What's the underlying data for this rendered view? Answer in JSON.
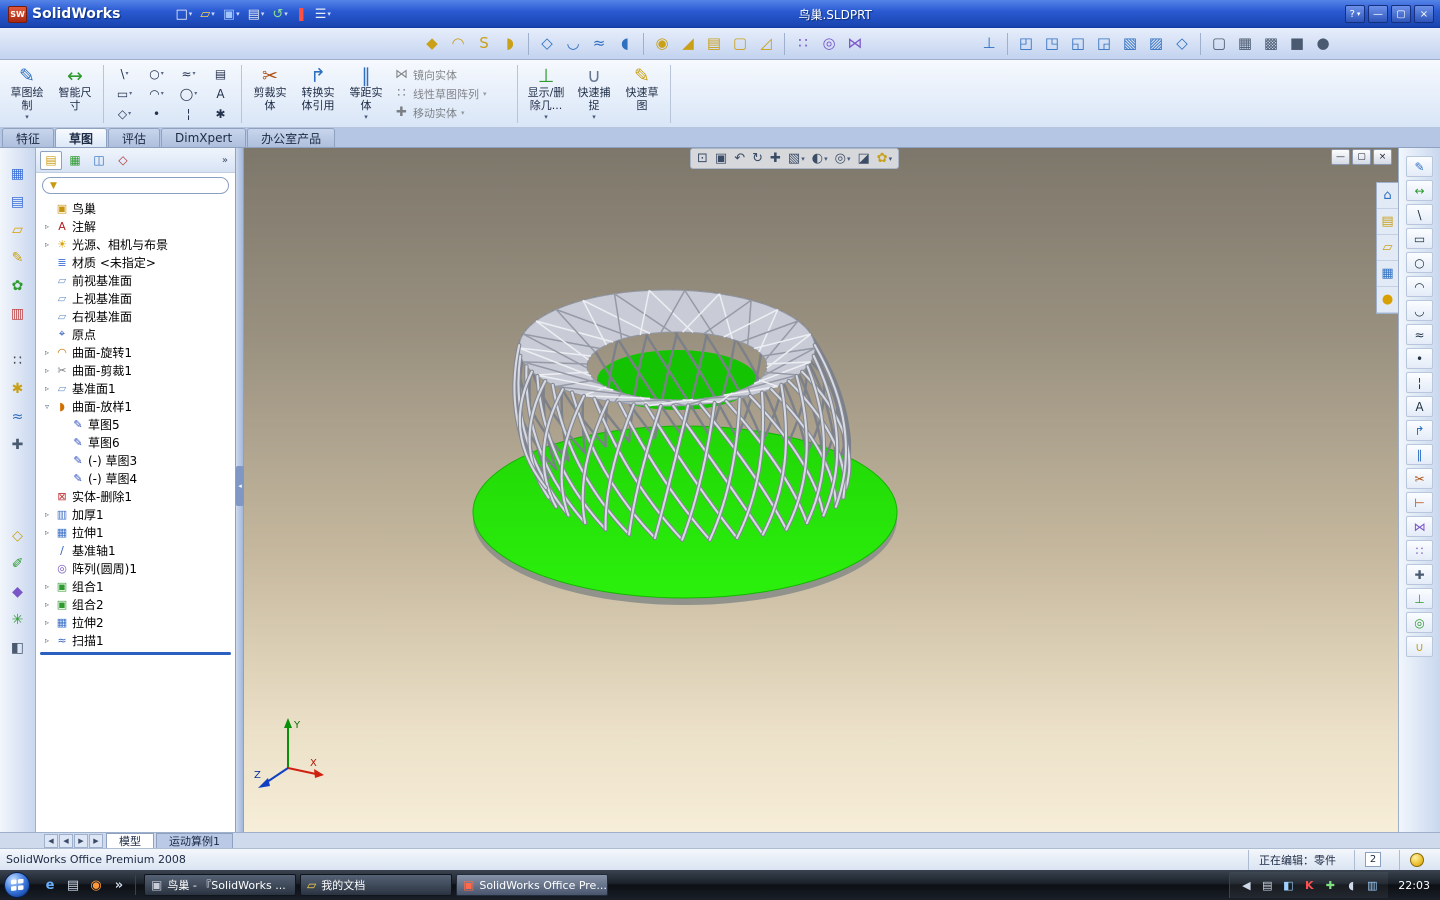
{
  "titlebar": {
    "app_name": "SolidWorks",
    "badge": "SW",
    "doc_title": "鸟巢.SLDPRT",
    "help_label": "?",
    "minimize": "—",
    "maximize": "▢",
    "close": "×",
    "toolbar": [
      {
        "n": "new-document",
        "g": "□",
        "c": "#f4f6fa",
        "dd": true
      },
      {
        "n": "open-document",
        "g": "▱",
        "c": "#ffd24a",
        "dd": true
      },
      {
        "n": "save",
        "g": "▣",
        "c": "#9fc4ff",
        "dd": true
      },
      {
        "n": "print",
        "g": "▤",
        "c": "#dfe6f2",
        "dd": true
      },
      {
        "n": "undo",
        "g": "↺",
        "c": "#8fe08f",
        "dd": true
      },
      {
        "n": "rebuild",
        "g": "❚",
        "c": "#ff5040"
      },
      {
        "n": "options",
        "g": "☰",
        "c": "#e8eef8",
        "dd": true
      }
    ]
  },
  "toolbar2": {
    "left": [
      {
        "n": "extruded-boss",
        "g": "◆",
        "c": "#caa018"
      },
      {
        "n": "revolved-boss",
        "g": "◠",
        "c": "#caa018"
      },
      {
        "n": "swept-boss",
        "g": "S",
        "c": "#caa018"
      },
      {
        "n": "lofted-boss",
        "g": "◗",
        "c": "#caa018"
      },
      {
        "sep": true
      },
      {
        "n": "extruded-cut",
        "g": "◇",
        "c": "#2f6fc0"
      },
      {
        "n": "revolved-cut",
        "g": "◡",
        "c": "#2f6fc0"
      },
      {
        "n": "swept-cut",
        "g": "≈",
        "c": "#2f6fc0"
      },
      {
        "n": "lofted-cut",
        "g": "◖",
        "c": "#2f6fc0"
      },
      {
        "sep": true
      },
      {
        "n": "fillet",
        "g": "◉",
        "c": "#caa018"
      },
      {
        "n": "chamfer",
        "g": "◢",
        "c": "#caa018"
      },
      {
        "n": "rib",
        "g": "▤",
        "c": "#caa018"
      },
      {
        "n": "shell",
        "g": "▢",
        "c": "#caa018"
      },
      {
        "n": "draft",
        "g": "◿",
        "c": "#caa018"
      },
      {
        "sep": true
      },
      {
        "n": "linear-pattern",
        "g": "∷",
        "c": "#7a55c8"
      },
      {
        "n": "circular-pattern",
        "g": "◎",
        "c": "#7a55c8"
      },
      {
        "n": "mirror-feature",
        "g": "⋈",
        "c": "#7a55c8"
      }
    ],
    "right": [
      {
        "n": "view-normal-to",
        "g": "⊥",
        "c": "#2f6fc0"
      },
      {
        "sep": true
      },
      {
        "n": "view-front",
        "g": "◰",
        "c": "#2f6fc0"
      },
      {
        "n": "view-back",
        "g": "◳",
        "c": "#2f6fc0"
      },
      {
        "n": "view-left",
        "g": "◱",
        "c": "#2f6fc0"
      },
      {
        "n": "view-right",
        "g": "◲",
        "c": "#2f6fc0"
      },
      {
        "n": "view-top",
        "g": "▧",
        "c": "#2f6fc0"
      },
      {
        "n": "view-bottom",
        "g": "▨",
        "c": "#2f6fc0"
      },
      {
        "n": "view-isometric",
        "g": "◇",
        "c": "#2f6fc0"
      },
      {
        "sep": true
      },
      {
        "n": "wireframe",
        "g": "▢",
        "c": "#4a5a70"
      },
      {
        "n": "hidden-lines-visible",
        "g": "▦",
        "c": "#4a5a70"
      },
      {
        "n": "hidden-lines-removed",
        "g": "▩",
        "c": "#4a5a70"
      },
      {
        "n": "shaded-with-edges",
        "g": "■",
        "c": "#4a5a70"
      },
      {
        "n": "shaded",
        "g": "●",
        "c": "#4a5a70"
      }
    ]
  },
  "command_manager": {
    "left": [
      {
        "n": "sketch",
        "label": "草图绘制",
        "g": "✎",
        "c": "#2f6fc0",
        "dd": true
      },
      {
        "n": "smart-dimension",
        "label": "智能尺寸",
        "g": "↔",
        "c": "#2f9a30"
      }
    ],
    "entities": [
      {
        "n": "line",
        "g": "\\",
        "dd": true
      },
      {
        "n": "circle",
        "g": "○",
        "dd": true
      },
      {
        "n": "spline",
        "g": "≈",
        "dd": true
      },
      {
        "n": "sketch-picture",
        "g": "▤"
      },
      {
        "n": "rectangle",
        "g": "▭",
        "dd": true
      },
      {
        "n": "arc",
        "g": "◠",
        "dd": true
      },
      {
        "n": "ellipse",
        "g": "◯",
        "dd": true
      },
      {
        "n": "text",
        "g": "A"
      },
      {
        "n": "polygon",
        "g": "◇",
        "dd": true
      },
      {
        "n": "point",
        "g": "•"
      },
      {
        "n": "centerline",
        "g": "¦"
      },
      {
        "n": "construction-geometry",
        "g": "✱"
      }
    ],
    "mid": [
      {
        "n": "trim-entities",
        "label": "剪裁实体",
        "g": "✂",
        "c": "#b05010"
      },
      {
        "n": "convert-entities",
        "label": "转换实体引用",
        "g": "↱",
        "c": "#2f6fc0"
      },
      {
        "n": "offset-entities",
        "label": "等距实体",
        "g": "∥",
        "c": "#2f6fc0",
        "dd": true
      }
    ],
    "stack": [
      {
        "n": "mirror-entities",
        "label": "镜向实体",
        "g": "⋈",
        "en": false
      },
      {
        "n": "linear-sketch-pattern",
        "label": "线性草图阵列",
        "g": "∷",
        "en": false,
        "dd": true
      },
      {
        "n": "move-entities",
        "label": "移动实体",
        "g": "✚",
        "en": false,
        "dd": true
      }
    ],
    "right": [
      {
        "n": "display-delete-relations",
        "label": "显示/删除几...",
        "g": "⊥",
        "c": "#2f9a30",
        "dd": true
      },
      {
        "n": "quick-snaps",
        "label": "快速捕捉",
        "g": "∪",
        "c": "#6a7890",
        "dd": true
      },
      {
        "n": "rapid-sketch",
        "label": "快速草图",
        "g": "✎",
        "c": "#caa018"
      }
    ],
    "tabs": [
      {
        "label": "特征"
      },
      {
        "label": "草图",
        "active": true
      },
      {
        "label": "评估"
      },
      {
        "label": "DimXpert"
      },
      {
        "label": "办公室产品"
      }
    ]
  },
  "left_toolbar": [
    {
      "n": "window-grid",
      "g": "▦",
      "c": "#3a6fd8"
    },
    {
      "n": "document",
      "g": "▤",
      "c": "#3a6fd8"
    },
    {
      "n": "folder",
      "g": "▱",
      "c": "#d8a000"
    },
    {
      "n": "note-pencil",
      "g": "✎",
      "c": "#caa018"
    },
    {
      "n": "flower-palette",
      "g": "✿",
      "c": "#2f9a30"
    },
    {
      "n": "chart",
      "g": "▥",
      "c": "#c04848"
    },
    {
      "sp": 14
    },
    {
      "n": "dots-grid",
      "g": "∷",
      "c": "#444444"
    },
    {
      "n": "sparkle",
      "g": "✱",
      "c": "#c8a018"
    },
    {
      "n": "curve",
      "g": "≈",
      "c": "#2f6fc0"
    },
    {
      "n": "cross-tool",
      "g": "✚",
      "c": "#4a5a70"
    },
    {
      "sp": 58
    },
    {
      "n": "diamond",
      "g": "◇",
      "c": "#caa018"
    },
    {
      "n": "pen",
      "g": "✐",
      "c": "#2f9a30"
    },
    {
      "n": "tag",
      "g": "◆",
      "c": "#7a55c8"
    },
    {
      "n": "asterisk",
      "g": "✳",
      "c": "#2f9a30"
    },
    {
      "n": "speaker",
      "g": "◧",
      "c": "#4a5a70"
    }
  ],
  "right_toolbar": [
    {
      "n": "sketch",
      "g": "✎",
      "c": "#2f6fc0"
    },
    {
      "n": "smart-dimension",
      "g": "↔",
      "c": "#2f9a30"
    },
    {
      "n": "line",
      "g": "\\",
      "c": "#223344"
    },
    {
      "n": "rectangle",
      "g": "▭",
      "c": "#223344"
    },
    {
      "n": "circle",
      "g": "○",
      "c": "#223344"
    },
    {
      "n": "centerpoint-arc",
      "g": "◠",
      "c": "#223344"
    },
    {
      "n": "tangent-arc",
      "g": "◡",
      "c": "#223344"
    },
    {
      "n": "spline",
      "g": "≈",
      "c": "#223344"
    },
    {
      "n": "point",
      "g": "•",
      "c": "#223344"
    },
    {
      "n": "centerline",
      "g": "¦",
      "c": "#223344"
    },
    {
      "n": "text",
      "g": "A",
      "c": "#223344"
    },
    {
      "n": "convert-entities",
      "g": "↱",
      "c": "#2f6fc0"
    },
    {
      "n": "offset-entities",
      "g": "∥",
      "c": "#2f6fc0"
    },
    {
      "n": "trim-entities",
      "g": "✂",
      "c": "#b05010"
    },
    {
      "n": "extend-entities",
      "g": "⊢",
      "c": "#b05010"
    },
    {
      "n": "mirror-entities",
      "g": "⋈",
      "c": "#7a55c8"
    },
    {
      "n": "linear-sketch-pattern",
      "g": "∷",
      "c": "#7a55c8"
    },
    {
      "n": "move-entities",
      "g": "✚",
      "c": "#4a5a70"
    },
    {
      "n": "add-relation",
      "g": "⊥",
      "c": "#2f9a30"
    },
    {
      "n": "display-relations",
      "g": "◎",
      "c": "#2f9a30"
    },
    {
      "n": "quick-snaps",
      "g": "∪",
      "c": "#caa018"
    }
  ],
  "task_pane": {
    "tabs": [
      {
        "n": "solidworks-resources",
        "g": "⌂",
        "c": "#2f6fc0"
      },
      {
        "n": "design-library",
        "g": "▤",
        "c": "#caa018"
      },
      {
        "n": "file-explorer",
        "g": "▱",
        "c": "#caa018"
      },
      {
        "n": "view-palette",
        "g": "▦",
        "c": "#2f6fc0"
      },
      {
        "n": "appearances",
        "g": "●",
        "c": "#d8a000"
      }
    ]
  },
  "feature_manager": {
    "tabs": [
      {
        "n": "featuremanager-design-tree",
        "g": "▤",
        "c": "#caa018"
      },
      {
        "n": "property-manager",
        "g": "▦",
        "c": "#2f9a30"
      },
      {
        "n": "configuration-manager",
        "g": "◫",
        "c": "#2f6fc0"
      },
      {
        "n": "dimxpert-manager",
        "g": "◇",
        "c": "#b03030"
      }
    ],
    "overflow_chevron": "»",
    "filter_glyph": "▼",
    "items": [
      {
        "n": "part-birds-nest",
        "g": "▣",
        "c": "#c79410",
        "label": "鸟巢"
      },
      {
        "n": "annotations",
        "g": "A",
        "c": "#b02020",
        "label": "注解",
        "ex": "closed"
      },
      {
        "n": "lights-cameras-scene",
        "g": "☀",
        "c": "#d8a000",
        "label": "光源、相机与布景",
        "ex": "closed"
      },
      {
        "n": "material",
        "g": "≣",
        "c": "#3a6fd8",
        "label": "材质 <未指定>"
      },
      {
        "n": "front-plane",
        "g": "▱",
        "c": "#6f94c8",
        "label": "前视基准面"
      },
      {
        "n": "top-plane",
        "g": "▱",
        "c": "#6f94c8",
        "label": "上视基准面"
      },
      {
        "n": "right-plane",
        "g": "▱",
        "c": "#6f94c8",
        "label": "右视基准面"
      },
      {
        "n": "origin",
        "g": "⌖",
        "c": "#2050c0",
        "label": "原点"
      },
      {
        "n": "surface-revolve1",
        "g": "◠",
        "c": "#d07000",
        "label": "曲面-旋转1",
        "ex": "closed"
      },
      {
        "n": "surface-trim1",
        "g": "✂",
        "c": "#707880",
        "label": "曲面-剪裁1",
        "ex": "closed"
      },
      {
        "n": "plane1",
        "g": "▱",
        "c": "#6f94c8",
        "label": "基准面1",
        "ex": "closed"
      },
      {
        "n": "surface-loft1",
        "g": "◗",
        "c": "#d07000",
        "label": "曲面-放样1",
        "ex": "open"
      },
      {
        "n": "sketch5",
        "g": "✎",
        "c": "#3050c0",
        "label": "草图5",
        "indent": 1
      },
      {
        "n": "sketch6",
        "g": "✎",
        "c": "#3050c0",
        "label": "草图6",
        "indent": 1
      },
      {
        "n": "sketch3",
        "g": "✎",
        "c": "#3050c0",
        "label": "(-) 草图3",
        "indent": 1
      },
      {
        "n": "sketch4",
        "g": "✎",
        "c": "#3050c0",
        "label": "(-) 草图4",
        "indent": 1
      },
      {
        "n": "body-delete1",
        "g": "⊠",
        "c": "#c03030",
        "label": "实体-删除1"
      },
      {
        "n": "thicken1",
        "g": "▥",
        "c": "#4070c0",
        "label": "加厚1",
        "ex": "closed"
      },
      {
        "n": "extrude1",
        "g": "▦",
        "c": "#3a70c8",
        "label": "拉伸1",
        "ex": "closed"
      },
      {
        "n": "axis1",
        "g": "∕",
        "c": "#3060c0",
        "label": "基准轴1"
      },
      {
        "n": "circular-pattern1",
        "g": "◎",
        "c": "#7050c0",
        "label": "阵列(圆周)1"
      },
      {
        "n": "combine1",
        "g": "▣",
        "c": "#2f9a30",
        "label": "组合1",
        "ex": "closed"
      },
      {
        "n": "combine2",
        "g": "▣",
        "c": "#2f9a30",
        "label": "组合2",
        "ex": "closed"
      },
      {
        "n": "extrude2",
        "g": "▦",
        "c": "#3a70c8",
        "label": "拉伸2",
        "ex": "closed"
      },
      {
        "n": "sweep1",
        "g": "≈",
        "c": "#3060c0",
        "label": "扫描1",
        "ex": "closed"
      }
    ]
  },
  "viewport": {
    "platter_color_top": "#21d606",
    "platter_color_bottom": "#2bf00c",
    "platter_edge": "#13b500",
    "nest_front": "#d7dae2",
    "nest_front_shadow": "#838792",
    "nest_back": "#7c8089",
    "rim_fill": "#c9ccd6",
    "view_toolbar": [
      {
        "n": "zoom-to-fit",
        "g": "⊡",
        "c": "#3b4c66"
      },
      {
        "n": "zoom-to-area",
        "g": "▣",
        "c": "#3b4c66"
      },
      {
        "n": "previous-view",
        "g": "↶",
        "c": "#3b4c66"
      },
      {
        "n": "rotate-view",
        "g": "↻",
        "c": "#3b4c66"
      },
      {
        "n": "pan",
        "g": "✚",
        "c": "#3b4c66"
      },
      {
        "n": "standard-views",
        "g": "▧",
        "c": "#3b4c66",
        "dd": true
      },
      {
        "n": "display-style",
        "g": "◐",
        "c": "#3b4c66",
        "dd": true
      },
      {
        "n": "hide-show-items",
        "g": "◎",
        "c": "#3b4c66",
        "dd": true
      },
      {
        "n": "section-view",
        "g": "◪",
        "c": "#3b4c66"
      },
      {
        "n": "appearances-scene",
        "g": "✿",
        "c": "#caa018",
        "dd": true
      }
    ],
    "triad": {
      "x_label": "X",
      "y_label": "Y",
      "z_label": "Z",
      "x_color": "#d02010",
      "y_color": "#089008",
      "z_color": "#1040c0"
    }
  },
  "bottom_tabs": {
    "nav": [
      "◀",
      "◀",
      "▶",
      "▶"
    ],
    "tabs": [
      {
        "n": "model",
        "label": "模型",
        "active": true
      },
      {
        "n": "motion-study-1",
        "label": "运动算例1"
      }
    ]
  },
  "statusbar": {
    "left": "SolidWorks Office Premium 2008",
    "editing": "正在编辑：零件",
    "badge": "2"
  },
  "taskbar": {
    "quick_launch": [
      {
        "n": "internet-explorer",
        "g": "e",
        "c": "#68b0ff"
      },
      {
        "n": "show-desktop",
        "g": "▤",
        "c": "#cfd8e8"
      },
      {
        "n": "media-player",
        "g": "◉",
        "c": "#ff9a3c"
      },
      {
        "n": "quick-launch-overflow",
        "g": "»",
        "c": "#cfd8e8"
      }
    ],
    "buttons": [
      {
        "n": "window-birds-nest",
        "label": "鸟巢 - 『SolidWorks ...",
        "g": "▣",
        "c": "#c8ccd8"
      },
      {
        "n": "window-my-documents",
        "label": "我的文档",
        "g": "▱",
        "c": "#ffd24a"
      },
      {
        "n": "window-solidworks-office",
        "label": "SolidWorks Office Pre...",
        "g": "▣",
        "c": "#ff6a4a",
        "active": true
      }
    ],
    "tray": [
      {
        "n": "hidden-icons",
        "g": "◀",
        "c": "#cfd8e8"
      },
      {
        "n": "ime-language",
        "g": "▤",
        "c": "#cfd8e8"
      },
      {
        "n": "graphics-settings",
        "g": "◧",
        "c": "#9fd0ff"
      },
      {
        "n": "antivirus-kaspersky",
        "g": "K",
        "c": "#ff5050"
      },
      {
        "n": "updates",
        "g": "✚",
        "c": "#7ee07e"
      },
      {
        "n": "volume",
        "g": "◖",
        "c": "#cfd8e8"
      },
      {
        "n": "network",
        "g": "▥",
        "c": "#9fd0ff"
      }
    ],
    "clock": "22:03"
  }
}
